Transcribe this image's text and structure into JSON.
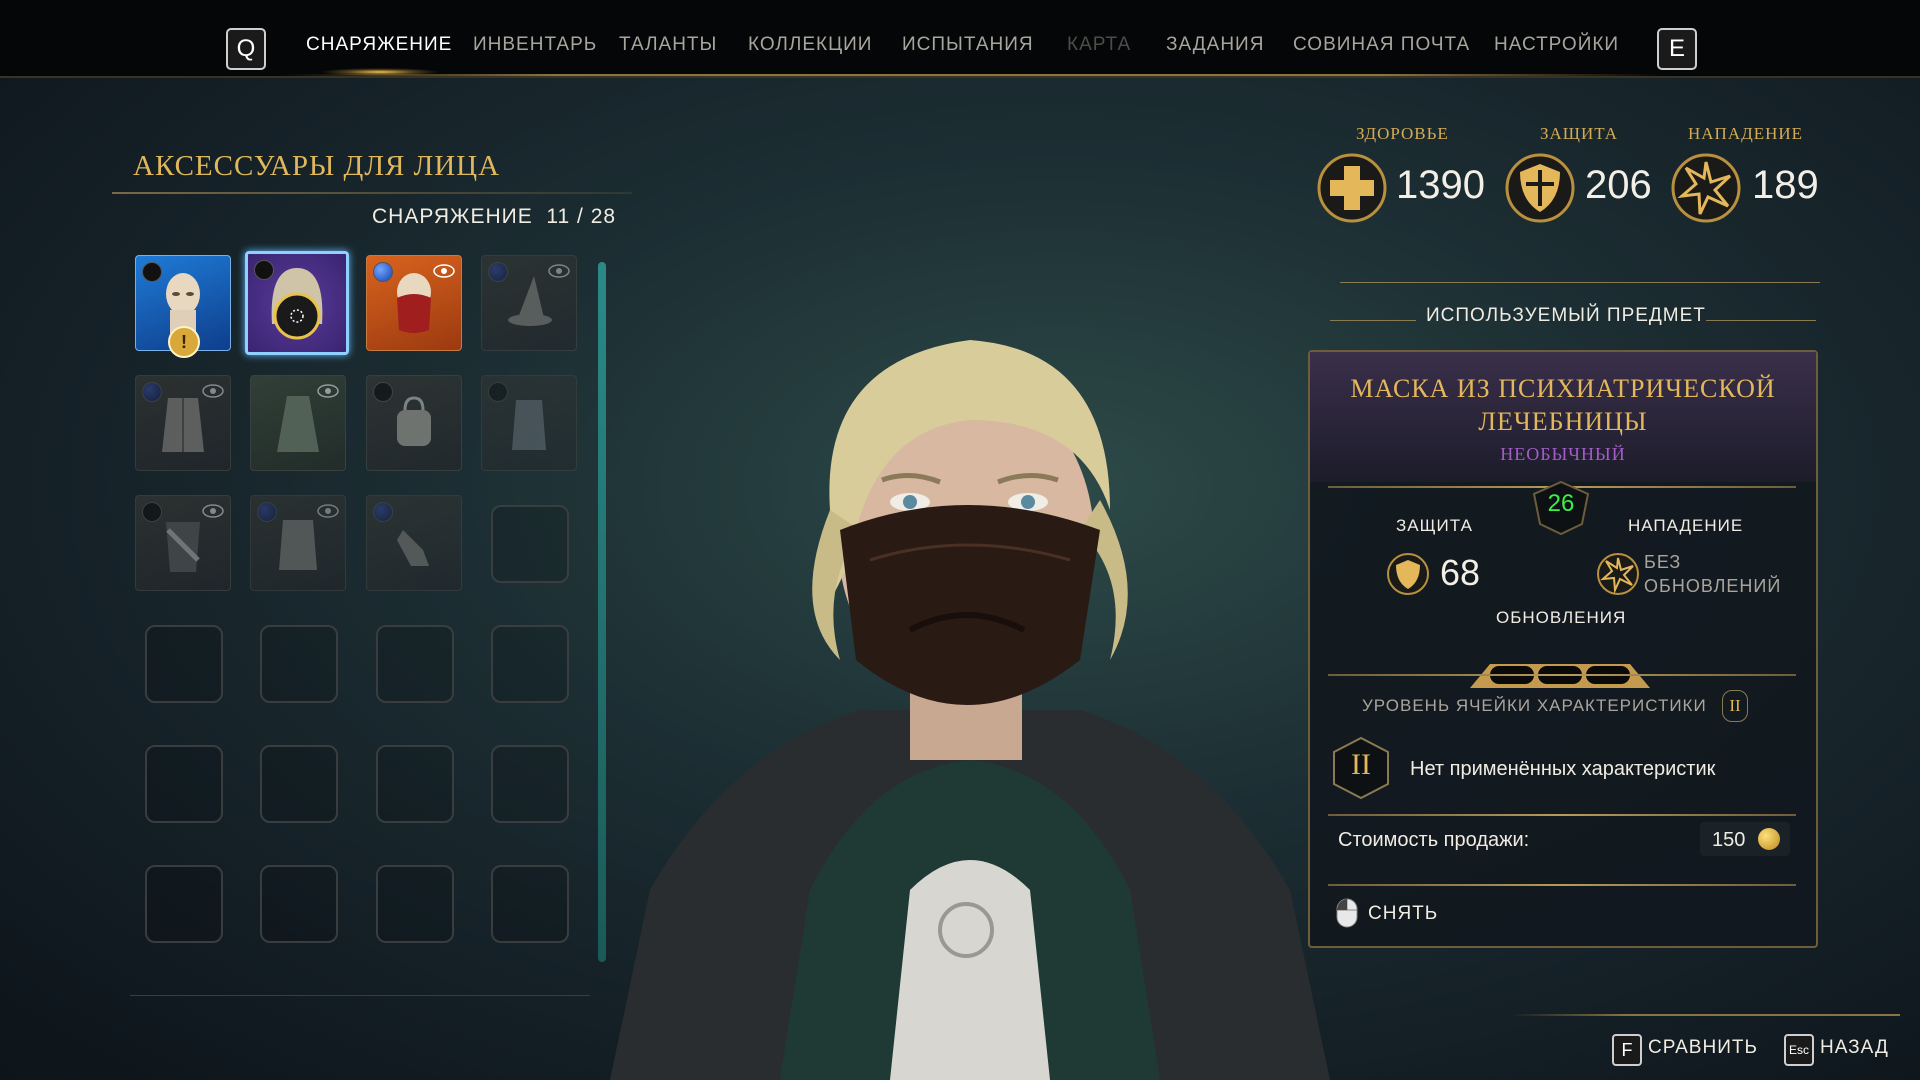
{
  "nav": {
    "prev_key": "Q",
    "next_key": "E",
    "tabs": [
      {
        "label": "СНАРЯЖЕНИЕ",
        "state": "active"
      },
      {
        "label": "ИНВЕНТАРЬ",
        "state": "normal"
      },
      {
        "label": "ТАЛАНТЫ",
        "state": "normal"
      },
      {
        "label": "КОЛЛЕКЦИИ",
        "state": "normal"
      },
      {
        "label": "ИСПЫТАНИЯ",
        "state": "normal"
      },
      {
        "label": "КАРТА",
        "state": "disabled"
      },
      {
        "label": "ЗАДАНИЯ",
        "state": "normal"
      },
      {
        "label": "СОВИНАЯ ПОЧТА",
        "state": "normal"
      },
      {
        "label": "НАСТРОЙКИ",
        "state": "normal"
      }
    ]
  },
  "gear": {
    "category_title": "АКСЕССУАРЫ ДЛЯ ЛИЦА",
    "count_label": "СНАРЯЖЕНИЕ",
    "count": "11 / 28",
    "slots": [
      {
        "item": "bald-head-mask",
        "bg": "blue",
        "dot": "black",
        "warning": true
      },
      {
        "item": "dark-hood",
        "bg": "purple",
        "dot": "black",
        "selected": true
      },
      {
        "item": "red-mask",
        "bg": "orange",
        "dot": "blue",
        "eye": true
      },
      {
        "item": "wizard-hat",
        "bg": "dim",
        "dot": "navy",
        "eye": true
      },
      {
        "item": "robe",
        "bg": "dim",
        "dot": "navy",
        "eye": true
      },
      {
        "item": "cloak",
        "bg": "green",
        "eye": true
      },
      {
        "item": "bag",
        "bg": "dim",
        "dot": "black"
      },
      {
        "item": "vest",
        "bg": "dim",
        "dot": "black"
      },
      {
        "item": "scarf",
        "bg": "dim",
        "dot": "black",
        "eye": true
      },
      {
        "item": "jacket",
        "bg": "dim",
        "dot": "navy",
        "eye": true
      },
      {
        "item": "gloves",
        "bg": "dim",
        "dot": "navy"
      }
    ],
    "empty_slots": 13
  },
  "stats": {
    "health": {
      "label": "ЗДОРОВЬЕ",
      "value": "1390",
      "icon": "health-cross-icon"
    },
    "defense": {
      "label": "ЗАЩИТА",
      "value": "206",
      "icon": "shield-icon"
    },
    "offense": {
      "label": "НАПАДЕНИЕ",
      "value": "189",
      "icon": "star-burst-icon"
    }
  },
  "equipped": {
    "section_title": "ИСПОЛЬЗУЕМЫЙ ПРЕДМЕТ",
    "item_name": "МАСКА ИЗ ПСИХИАТРИЧЕСКОЙ ЛЕЧЕБНИЦЫ",
    "rarity": "НЕОБЫЧНЫЙ",
    "level": "26",
    "defense_label": "ЗАЩИТА",
    "defense_value": "68",
    "offense_label": "НАПАДЕНИЕ",
    "offense_value": "БЕЗ ОБНОВЛЕНИЙ",
    "upgrades_label": "ОБНОВЛЕНИЯ",
    "upgrade_slots_filled": 0,
    "upgrade_slots_total": 3,
    "trait_slot_label": "УРОВЕНЬ ЯЧЕЙКИ ХАРАКТЕРИСТИКИ",
    "trait_level": "II",
    "trait_text": "Нет применённых характеристик",
    "sell_label": "Стоимость продажи:",
    "sell_value": "150",
    "unequip_label": "СНЯТЬ"
  },
  "prompts": {
    "compare_key": "F",
    "compare_label": "СРАВНИТЬ",
    "back_key": "Esc",
    "back_label": "НАЗАД"
  },
  "colors": {
    "accent_gold": "#e0b85a",
    "rarity_purple": "#a35cc8",
    "level_green": "#3cf04a"
  }
}
